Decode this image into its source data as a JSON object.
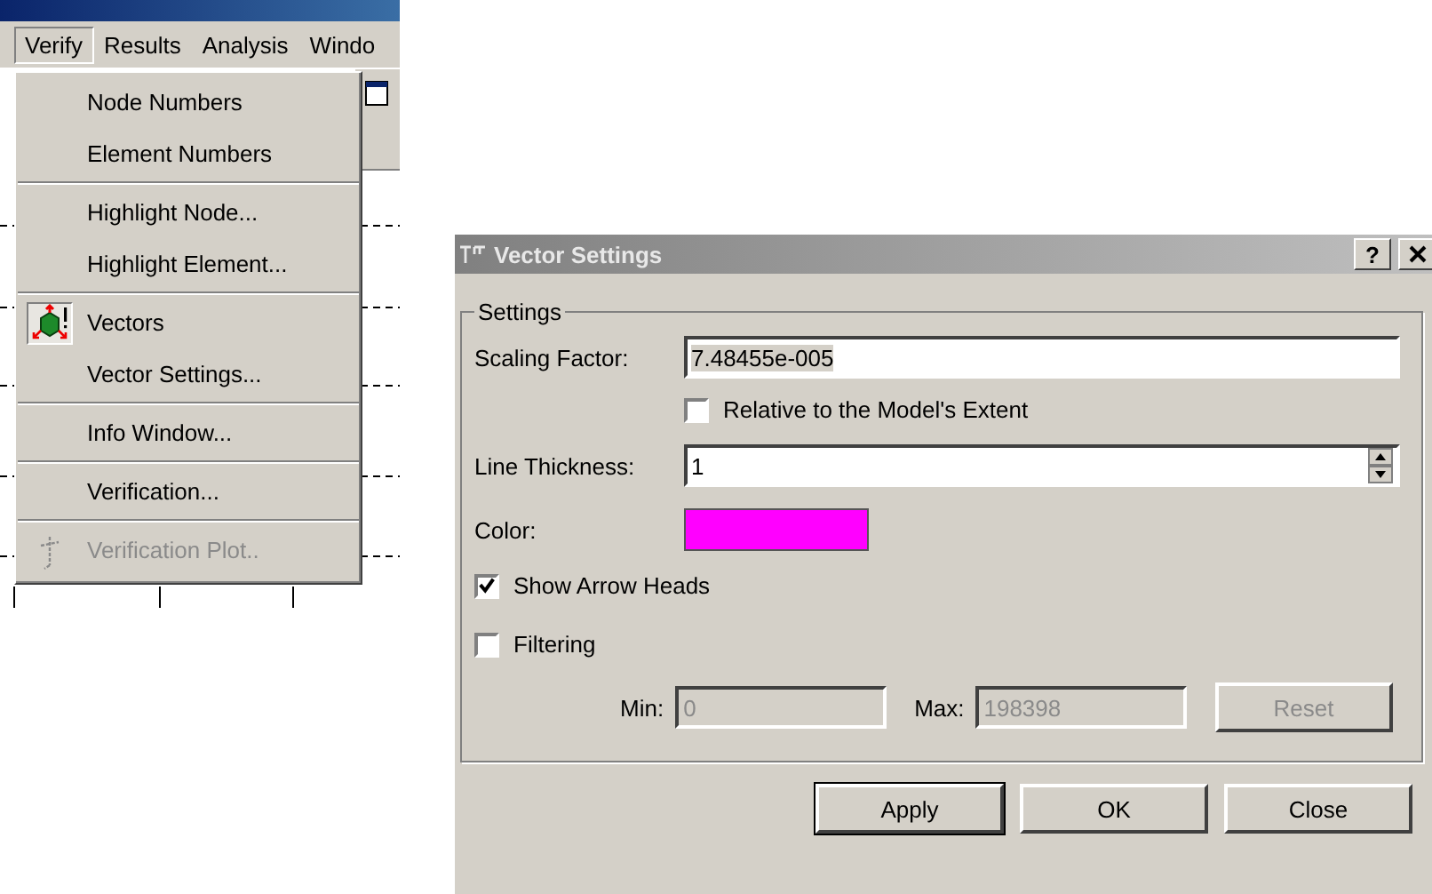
{
  "app": {
    "menubar": [
      {
        "label": "Verify",
        "selected": true
      },
      {
        "label": "Results",
        "selected": false
      },
      {
        "label": "Analysis",
        "selected": false
      },
      {
        "label": "Windo",
        "selected": false
      }
    ]
  },
  "menu": {
    "items": [
      {
        "kind": "item",
        "label": "Node Numbers",
        "disabled": false
      },
      {
        "kind": "item",
        "label": "Element Numbers",
        "disabled": false
      },
      {
        "kind": "separator"
      },
      {
        "kind": "item",
        "label": "Highlight Node...",
        "disabled": false
      },
      {
        "kind": "item",
        "label": "Highlight Element...",
        "disabled": false
      },
      {
        "kind": "separator"
      },
      {
        "kind": "toggle",
        "label": "Vectors",
        "checked": true,
        "disabled": false
      },
      {
        "kind": "item",
        "label": "Vector Settings...",
        "disabled": false
      },
      {
        "kind": "separator"
      },
      {
        "kind": "item",
        "label": "Info Window...",
        "disabled": false
      },
      {
        "kind": "separator"
      },
      {
        "kind": "item",
        "label": "Verification...",
        "disabled": false
      },
      {
        "kind": "separator"
      },
      {
        "kind": "icon-item",
        "label": "Verification Plot..",
        "disabled": true
      }
    ]
  },
  "dialog": {
    "title": "Vector Settings",
    "help": "?",
    "group_label": "Settings",
    "scaling": {
      "label": "Scaling Factor:",
      "value": "7.48455e-005"
    },
    "relative": {
      "label": "Relative to the Model's Extent",
      "checked": false
    },
    "thickness": {
      "label": "Line Thickness:",
      "value": "1"
    },
    "color": {
      "label": "Color:",
      "color": "#ff00ff"
    },
    "arrow_heads": {
      "label": "Show Arrow Heads",
      "checked": true
    },
    "filtering": {
      "label": "Filtering",
      "checked": false
    },
    "filter_range": {
      "disabled": true,
      "min_label": "Min:",
      "min_value": "0",
      "max_label": "Max:",
      "max_value": "198398",
      "reset": "Reset"
    },
    "buttons": [
      "Apply",
      "OK",
      "Close"
    ]
  }
}
